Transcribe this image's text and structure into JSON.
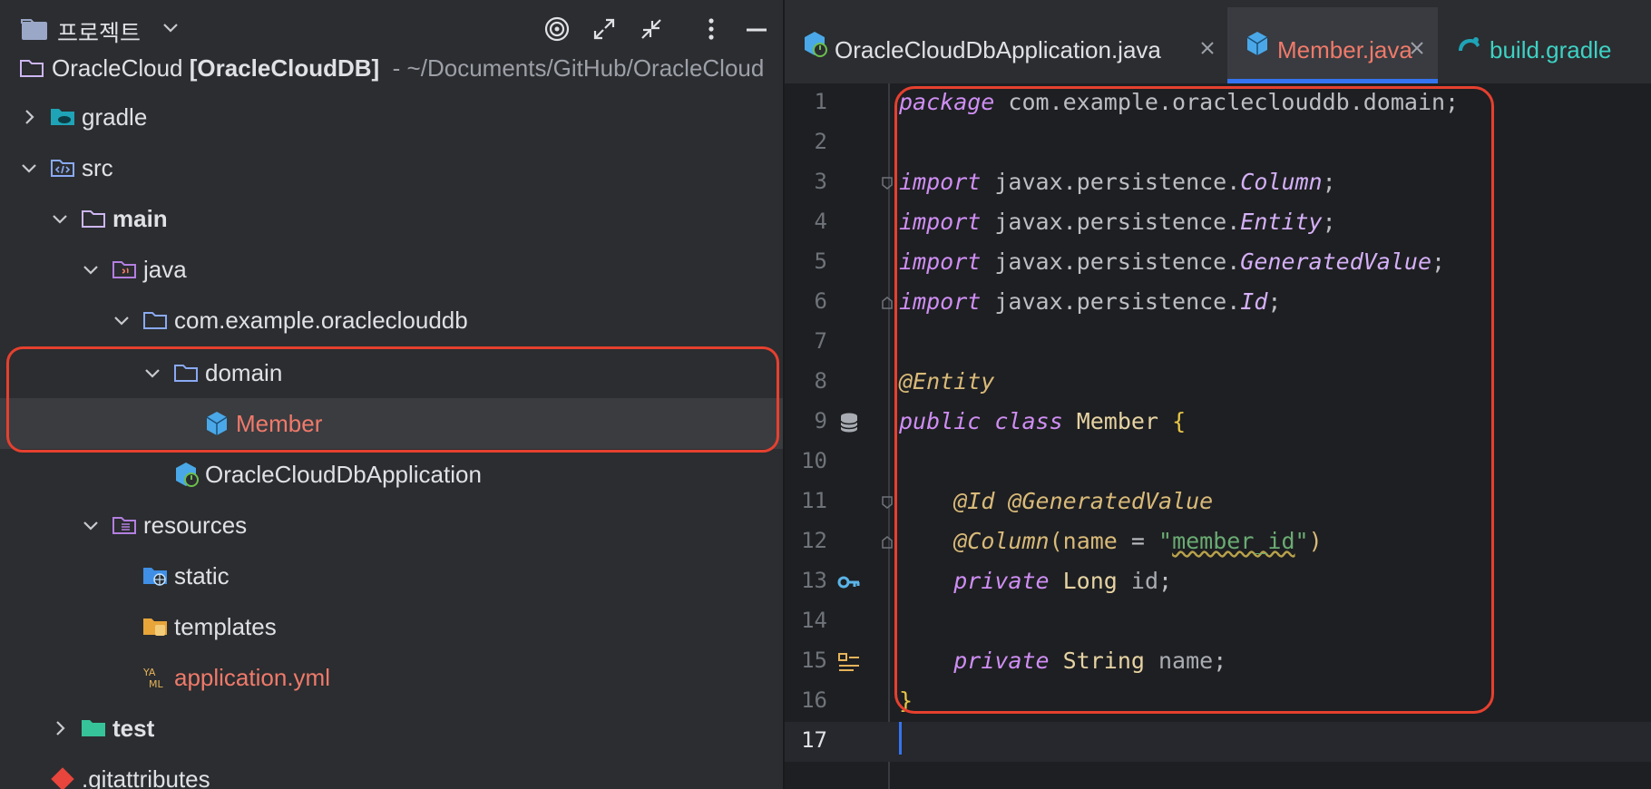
{
  "project_panel": {
    "title": "프로젝트",
    "tree": [
      {
        "id": "root",
        "name": "OracleCloud",
        "module": "[OracleCloudDB]",
        "path": "- ~/Documents/GitHub/OracleCloud",
        "icon": "folder-icon"
      },
      {
        "id": "gradle",
        "name": "gradle",
        "icon": "gradle-folder-icon",
        "expanded": false
      },
      {
        "id": "src",
        "name": "src",
        "icon": "source-folder-icon",
        "expanded": true
      },
      {
        "id": "main",
        "name": "main",
        "icon": "folder-icon",
        "expanded": true
      },
      {
        "id": "java",
        "name": "java",
        "icon": "java-source-root-icon",
        "expanded": true
      },
      {
        "id": "package",
        "name": "com.example.oracleclouddb",
        "icon": "package-icon",
        "expanded": true
      },
      {
        "id": "domain",
        "name": "domain",
        "icon": "package-icon",
        "expanded": true
      },
      {
        "id": "member",
        "name": "Member",
        "icon": "java-class-icon",
        "selected": true
      },
      {
        "id": "app",
        "name": "OracleCloudDbApplication",
        "icon": "spring-boot-class-icon"
      },
      {
        "id": "resources",
        "name": "resources",
        "icon": "resources-folder-icon",
        "expanded": true
      },
      {
        "id": "static",
        "name": "static",
        "icon": "web-folder-icon"
      },
      {
        "id": "templates",
        "name": "templates",
        "icon": "templates-folder-icon"
      },
      {
        "id": "appyml",
        "name": "application.yml",
        "icon": "yaml-icon"
      },
      {
        "id": "test",
        "name": "test",
        "icon": "test-folder-icon",
        "expanded": false
      },
      {
        "id": "gitattributes",
        "name": ".gitattributes",
        "icon": "git-icon"
      }
    ]
  },
  "editor": {
    "tabs": [
      {
        "label": "OracleCloudDbApplication.java",
        "icon": "spring-boot-class-icon",
        "active": false
      },
      {
        "label": "Member.java",
        "icon": "java-class-icon",
        "active": true
      },
      {
        "label": "build.gradle",
        "icon": "gradle-icon",
        "active": false
      }
    ],
    "line_numbers": [
      "1",
      "2",
      "3",
      "4",
      "5",
      "6",
      "7",
      "8",
      "9",
      "10",
      "11",
      "12",
      "13",
      "14",
      "15",
      "16",
      "17"
    ],
    "code": {
      "l1_kw": "package",
      "l1_rest": " com.example.oracleclouddb.domain;",
      "import_kw": "import",
      "l3_pkg": " javax.persistence.",
      "l3_cls": "Column",
      "semi": ";",
      "l4_pkg": " javax.persistence.",
      "l4_cls": "Entity",
      "l5_pkg": " javax.persistence.",
      "l5_cls": "GeneratedValue",
      "l6_pkg": " javax.persistence.",
      "l6_cls": "Id",
      "l8_ann": "@Entity",
      "l9_public": "public",
      "l9_class": "class",
      "l9_name": " Member ",
      "l9_brace": "{",
      "l11_ann": "@Id @GeneratedValue",
      "l12_ann": "@Column",
      "l12_paren_open": "(",
      "l12_param": "name",
      "l12_eq": " = ",
      "l12_q1": "\"",
      "l12_str": "member_id",
      "l12_q2": "\"",
      "l12_paren_close": ")",
      "private_kw": "private",
      "l13_type": " Long ",
      "l13_field": "id",
      "l15_type": " String ",
      "l15_field": "name",
      "l16_brace": "}"
    }
  },
  "colors": {
    "highlight": "#e6402f",
    "accent": "#3574f0",
    "modified_file": "#f07a6a"
  }
}
